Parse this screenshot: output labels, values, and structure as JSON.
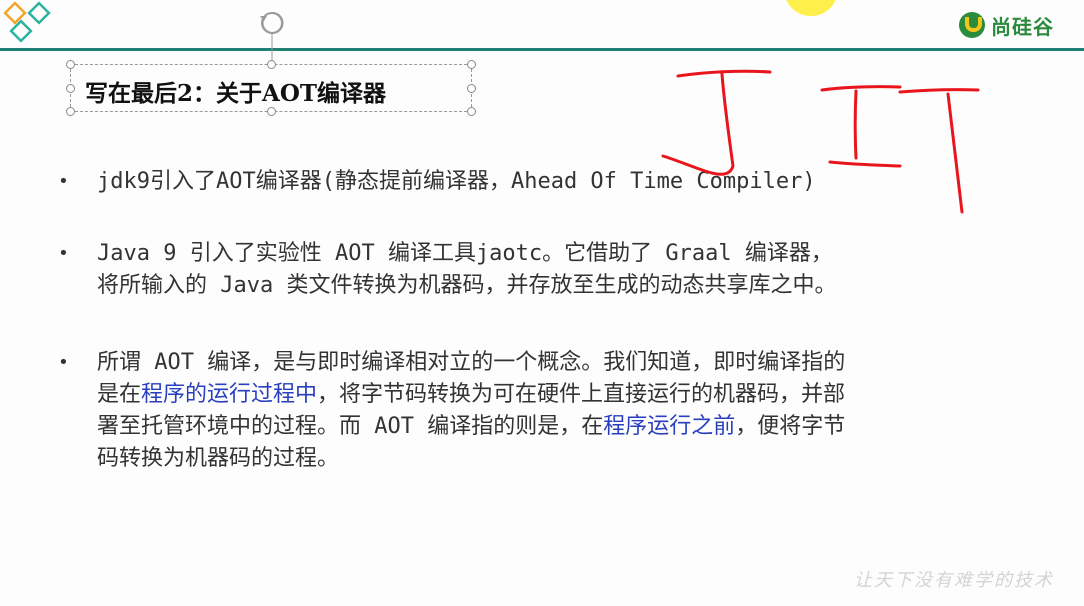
{
  "slide": {
    "title": "写在最后2：关于AOT编译器",
    "bullets": [
      {
        "lines": [
          [
            {
              "text": "jdk9引入了AOT编译器(静态提前编译器，Ahead Of Time Compiler)",
              "highlight": false
            }
          ]
        ]
      },
      {
        "lines": [
          [
            {
              "text": "Java 9 引入了实验性 AOT 编译工具jaotc。它借助了 Graal 编译器，",
              "highlight": false
            }
          ],
          [
            {
              "text": "将所输入的 Java 类文件转换为机器码，并存放至生成的动态共享库之中。",
              "highlight": false
            }
          ]
        ]
      },
      {
        "lines": [
          [
            {
              "text": "所谓 AOT 编译，是与即时编译相对立的一个概念。我们知道，即时编译指的",
              "highlight": false
            }
          ],
          [
            {
              "text": "是在",
              "highlight": false
            },
            {
              "text": "程序的运行过程中",
              "highlight": true
            },
            {
              "text": "，将字节码转换为可在硬件上直接运行的机器码，并部",
              "highlight": false
            }
          ],
          [
            {
              "text": "署至托管环境中的过程。而 AOT 编译指的则是，在",
              "highlight": false
            },
            {
              "text": "程序运行之前",
              "highlight": true
            },
            {
              "text": "，便将字节",
              "highlight": false
            }
          ],
          [
            {
              "text": "码转换为机器码的过程。",
              "highlight": false
            }
          ]
        ]
      }
    ],
    "bullet_symbol": "•"
  },
  "brand": {
    "name": "尚硅谷",
    "icon": "brand-logo-icon",
    "color": "#2b8b3d"
  },
  "watermark": "让天下没有难学的技术",
  "annotation": {
    "description": "red-handwritten-JIT",
    "color": "#e8161c"
  },
  "colors": {
    "accent_line": "#1f7f73",
    "highlight_text": "#2a3fbf"
  }
}
